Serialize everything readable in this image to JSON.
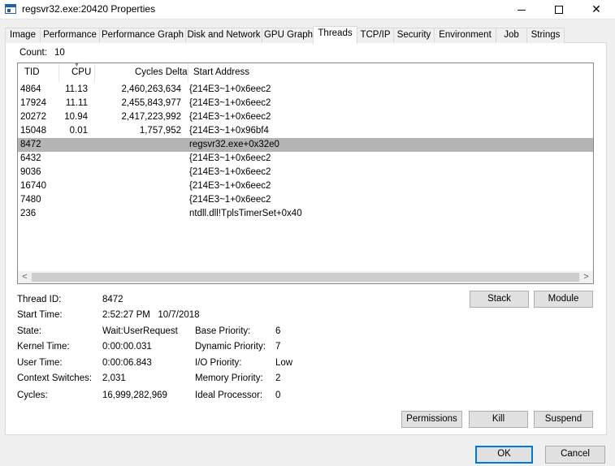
{
  "window": {
    "title": "regsvr32.exe:20420 Properties",
    "minimize_glyph": "",
    "close_glyph": "✕"
  },
  "tabs": [
    {
      "label": "Image",
      "active": false
    },
    {
      "label": "Performance",
      "active": false
    },
    {
      "label": "Performance Graph",
      "active": false
    },
    {
      "label": "Disk and Network",
      "active": false
    },
    {
      "label": "GPU Graph",
      "active": false
    },
    {
      "label": "Threads",
      "active": true
    },
    {
      "label": "TCP/IP",
      "active": false
    },
    {
      "label": "Security",
      "active": false
    },
    {
      "label": "Environment",
      "active": false
    },
    {
      "label": "Job",
      "active": false
    },
    {
      "label": "Strings",
      "active": false
    }
  ],
  "threads": {
    "count_label": "Count:",
    "count_value": "10",
    "columns": {
      "tid": "TID",
      "cpu": "CPU",
      "cycles": "Cycles Delta",
      "address": "Start Address"
    },
    "rows": [
      {
        "tid": "4864",
        "cpu": "11.13",
        "cycles": "2,460,263,634",
        "address": "{214E3~1+0x6eec2",
        "selected": false
      },
      {
        "tid": "17924",
        "cpu": "11.11",
        "cycles": "2,455,843,977",
        "address": "{214E3~1+0x6eec2",
        "selected": false
      },
      {
        "tid": "20272",
        "cpu": "10.94",
        "cycles": "2,417,223,992",
        "address": "{214E3~1+0x6eec2",
        "selected": false
      },
      {
        "tid": "15048",
        "cpu": "0.01",
        "cycles": "1,757,952",
        "address": "{214E3~1+0x96bf4",
        "selected": false
      },
      {
        "tid": "8472",
        "cpu": "",
        "cycles": "",
        "address": "regsvr32.exe+0x32e0",
        "selected": true
      },
      {
        "tid": "6432",
        "cpu": "",
        "cycles": "",
        "address": "{214E3~1+0x6eec2",
        "selected": false
      },
      {
        "tid": "9036",
        "cpu": "",
        "cycles": "",
        "address": "{214E3~1+0x6eec2",
        "selected": false
      },
      {
        "tid": "16740",
        "cpu": "",
        "cycles": "",
        "address": "{214E3~1+0x6eec2",
        "selected": false
      },
      {
        "tid": "7480",
        "cpu": "",
        "cycles": "",
        "address": "{214E3~1+0x6eec2",
        "selected": false
      },
      {
        "tid": "236",
        "cpu": "",
        "cycles": "",
        "address": "ntdll.dll!TplsTimerSet+0x40",
        "selected": false
      }
    ],
    "scroll_left": "<",
    "scroll_right": ">"
  },
  "details": {
    "thread_id_label": "Thread ID:",
    "thread_id": "8472",
    "start_time_label": "Start Time:",
    "start_time": "2:52:27 PM   10/7/2018",
    "state_label": "State:",
    "state": "Wait:UserRequest",
    "kernel_time_label": "Kernel Time:",
    "kernel_time": "0:00:00.031",
    "user_time_label": "User Time:",
    "user_time": "0:00:06.843",
    "context_switches_label": "Context Switches:",
    "context_switches": "2,031",
    "cycles_label": "Cycles:",
    "cycles": "16,999,282,969",
    "base_priority_label": "Base Priority:",
    "base_priority": "6",
    "dynamic_priority_label": "Dynamic Priority:",
    "dynamic_priority": "7",
    "io_priority_label": "I/O Priority:",
    "io_priority": "Low",
    "memory_priority_label": "Memory Priority:",
    "memory_priority": "2",
    "ideal_processor_label": "Ideal Processor:",
    "ideal_processor": "0"
  },
  "buttons": {
    "stack": "Stack",
    "module": "Module",
    "permissions": "Permissions",
    "kill": "Kill",
    "suspend": "Suspend",
    "ok": "OK",
    "cancel": "Cancel"
  }
}
